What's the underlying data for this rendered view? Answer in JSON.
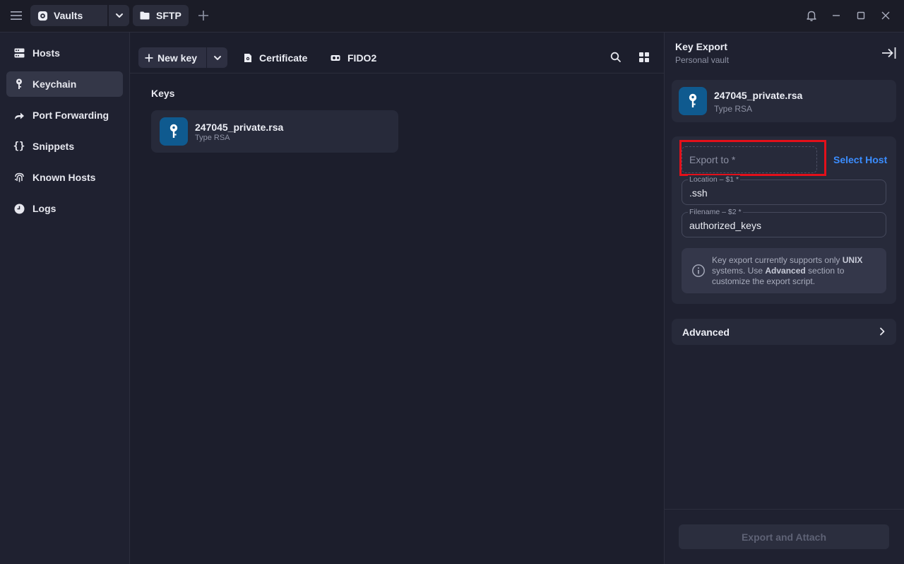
{
  "titlebar": {
    "vault_tab_label": "Vaults",
    "sftp_tab_label": "SFTP",
    "icons": [
      "menu-icon",
      "vault-icon",
      "chevron-down-icon",
      "folder-icon",
      "plus-icon",
      "bell-icon",
      "minimize-icon",
      "maximize-icon",
      "close-icon"
    ]
  },
  "sidebar": {
    "items": [
      {
        "label": "Hosts",
        "icon": "hosts-icon"
      },
      {
        "label": "Keychain",
        "icon": "key-icon",
        "active": true
      },
      {
        "label": "Port Forwarding",
        "icon": "port-forward-icon"
      },
      {
        "label": "Snippets",
        "icon": "braces-icon"
      },
      {
        "label": "Known Hosts",
        "icon": "fingerprint-icon"
      },
      {
        "label": "Logs",
        "icon": "clock-icon"
      }
    ]
  },
  "toolbar": {
    "new_key_label": "New key",
    "certificate_label": "Certificate",
    "fido2_label": "FIDO2"
  },
  "main": {
    "section_title": "Keys",
    "keys": [
      {
        "name": "247045_private.rsa",
        "type": "Type RSA"
      }
    ]
  },
  "panel": {
    "title": "Key Export",
    "subtitle": "Personal vault",
    "key": {
      "name": "247045_private.rsa",
      "type": "Type RSA"
    },
    "export_to_placeholder": "Export to *",
    "select_host_label": "Select Host",
    "location_label": "Location – $1 *",
    "location_value": ".ssh",
    "filename_label": "Filename – $2 *",
    "filename_value": "authorized_keys",
    "info_part1": "Key export currently supports only ",
    "info_bold1": "UNIX",
    "info_part2": " systems. Use ",
    "info_bold2": "Advanced",
    "info_part3": " section to customize the export script.",
    "advanced_label": "Advanced",
    "export_button_label": "Export and Attach"
  },
  "colors": {
    "accent": "#3b8dff",
    "key_icon_bg": "#0f5a8f",
    "highlight": "#e3101a"
  }
}
